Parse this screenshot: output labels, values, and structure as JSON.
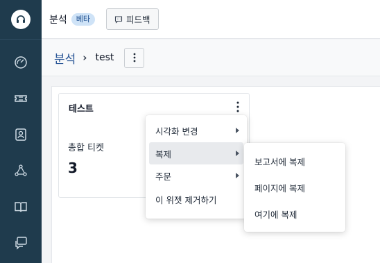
{
  "sidebar": {
    "logo_icon": "headset-icon",
    "items": [
      {
        "name": "dashboard-icon"
      },
      {
        "name": "ticket-icon"
      },
      {
        "name": "contacts-icon"
      },
      {
        "name": "organization-icon"
      },
      {
        "name": "knowledge-icon"
      },
      {
        "name": "conversations-icon"
      }
    ],
    "background": "#1f3b4d"
  },
  "topbar": {
    "title": "분석",
    "badge": "베타",
    "feedback_label": "피드백",
    "feedback_icon": "feedback-icon"
  },
  "breadcrumb": {
    "parent": "분석",
    "separator": "›",
    "current": "test"
  },
  "widget": {
    "title": "테스트",
    "metric_label": "총합 티켓",
    "metric_value": "3"
  },
  "context_menu": {
    "items": [
      {
        "label": "시각화 변경",
        "has_submenu": true
      },
      {
        "label": "복제",
        "has_submenu": true,
        "active": true
      },
      {
        "label": "주문",
        "has_submenu": true
      },
      {
        "label": "이 위젯 제거하기",
        "has_submenu": false
      }
    ]
  },
  "submenu": {
    "items": [
      {
        "label": "보고서에 복제"
      },
      {
        "label": "페이지에 복제"
      },
      {
        "label": "여기에 복제"
      }
    ]
  },
  "colors": {
    "accent": "#2b5797",
    "badge_bg": "#cfe3f7"
  }
}
